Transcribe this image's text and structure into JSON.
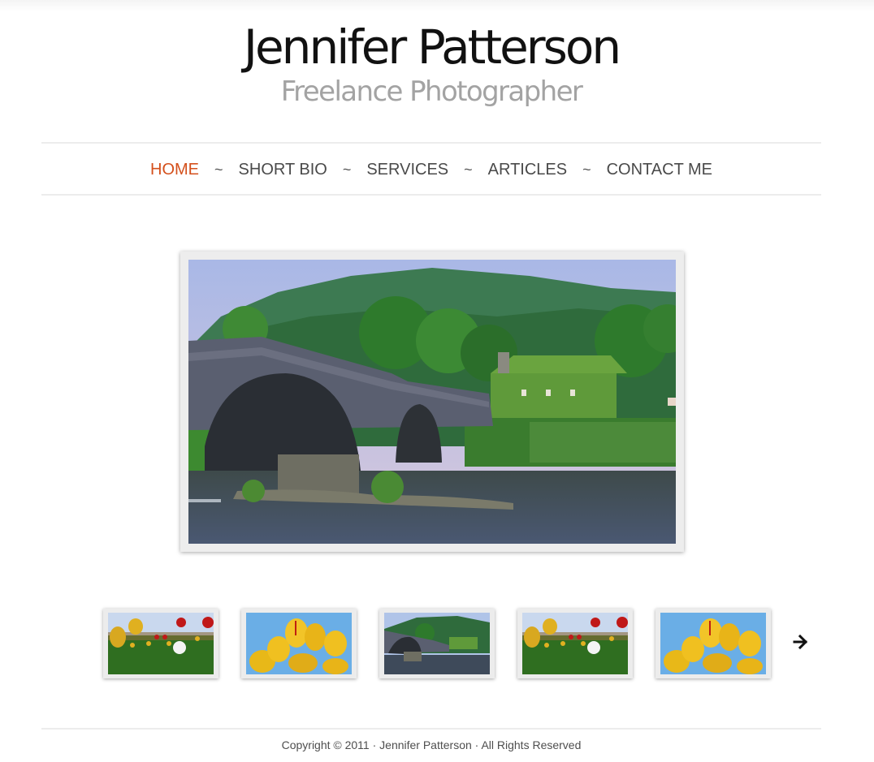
{
  "header": {
    "title": "Jennifer Patterson",
    "subtitle": "Freelance Photographer"
  },
  "nav": {
    "separator": "~",
    "active_color": "#d4501c",
    "items": [
      {
        "label": "HOME",
        "active": true
      },
      {
        "label": "SHORT BIO",
        "active": false
      },
      {
        "label": "SERVICES",
        "active": false
      },
      {
        "label": "ARTICLES",
        "active": false
      },
      {
        "label": "CONTACT ME",
        "active": false
      }
    ]
  },
  "slideshow": {
    "main_image": "stone-arch-bridge-landscape",
    "thumbnails": [
      {
        "image": "tulip-field"
      },
      {
        "image": "yellow-tulips"
      },
      {
        "image": "stone-arch-bridge-landscape"
      },
      {
        "image": "tulip-field"
      },
      {
        "image": "yellow-tulips"
      }
    ],
    "next_icon": "arrow-right-icon"
  },
  "footer": {
    "copyright": "Copyright © 2011 · Jennifer Patterson · All Rights Reserved"
  }
}
